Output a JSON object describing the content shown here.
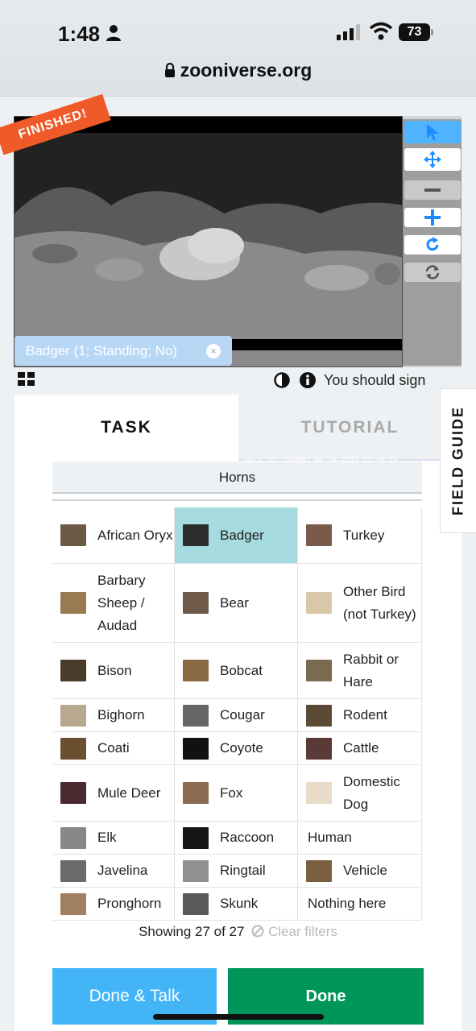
{
  "status_bar": {
    "time": "1:48",
    "battery": "73"
  },
  "browser": {
    "url": "zooniverse.org"
  },
  "viewer": {
    "banner": "FINISHED!",
    "camera_meta": "mera ID: CAM001     06-10-2024    22:40:16",
    "annotation": "Badger (1; Standing; No)",
    "annotation_close": "×"
  },
  "info_row": {
    "signin": "You should sign"
  },
  "tabs": {
    "task": "TASK",
    "tutorial": "TUTORIAL"
  },
  "field_guide": "FIELD GUIDE",
  "filter_bar": "Horns",
  "choices": [
    {
      "label": "African Oryx",
      "thumb": "#6a5a44",
      "selected": false
    },
    {
      "label": "Badger",
      "thumb": "#2c2c2c",
      "selected": true
    },
    {
      "label": "Turkey",
      "thumb": "#7a5a4a",
      "selected": false
    },
    {
      "label": "Barbary Sheep / Audad",
      "thumb": "#9a7a52",
      "selected": false
    },
    {
      "label": "Bear",
      "thumb": "#6f5a4a",
      "selected": false
    },
    {
      "label": "Other Bird (not Turkey)",
      "thumb": "#d8c8a8",
      "selected": false
    },
    {
      "label": "Bison",
      "thumb": "#4a3a2a",
      "selected": false
    },
    {
      "label": "Bobcat",
      "thumb": "#8a6a44",
      "selected": false
    },
    {
      "label": "Rabbit or Hare",
      "thumb": "#7a6a50",
      "selected": false
    },
    {
      "label": "Bighorn",
      "thumb": "#b8a890",
      "selected": false
    },
    {
      "label": "Cougar",
      "thumb": "#666666",
      "selected": false
    },
    {
      "label": "Rodent",
      "thumb": "#5a4a36",
      "selected": false
    },
    {
      "label": "Coati",
      "thumb": "#6a5030",
      "selected": false
    },
    {
      "label": "Coyote",
      "thumb": "#111111",
      "selected": false
    },
    {
      "label": "Cattle",
      "thumb": "#5a3a36",
      "selected": false
    },
    {
      "label": "Mule Deer",
      "thumb": "#4a2a30",
      "selected": false
    },
    {
      "label": "Fox",
      "thumb": "#8a6a50",
      "selected": false
    },
    {
      "label": "Domestic Dog",
      "thumb": "#e8dcc8",
      "selected": false
    },
    {
      "label": "Elk",
      "thumb": "#888888",
      "selected": false
    },
    {
      "label": "Raccoon",
      "thumb": "#151515",
      "selected": false
    },
    {
      "label": "Human",
      "thumb": "",
      "selected": false
    },
    {
      "label": "Javelina",
      "thumb": "#6a6a6a",
      "selected": false
    },
    {
      "label": "Ringtail",
      "thumb": "#909090",
      "selected": false
    },
    {
      "label": "Vehicle",
      "thumb": "#7a6040",
      "selected": false
    },
    {
      "label": "Pronghorn",
      "thumb": "#a08060",
      "selected": false
    },
    {
      "label": "Skunk",
      "thumb": "#5a5a5a",
      "selected": false
    },
    {
      "label": "Nothing here",
      "thumb": "",
      "selected": false
    }
  ],
  "footer": {
    "showing": "Showing 27 of 27",
    "clear_filters": "Clear filters",
    "done_talk": "Done & Talk",
    "done": "Done"
  },
  "colors": {
    "banner": "#f05a28",
    "selected": "#a6dbe0",
    "done": "#00965a",
    "done_talk": "#43b5f7",
    "tool_active": "#4fb3ff"
  }
}
